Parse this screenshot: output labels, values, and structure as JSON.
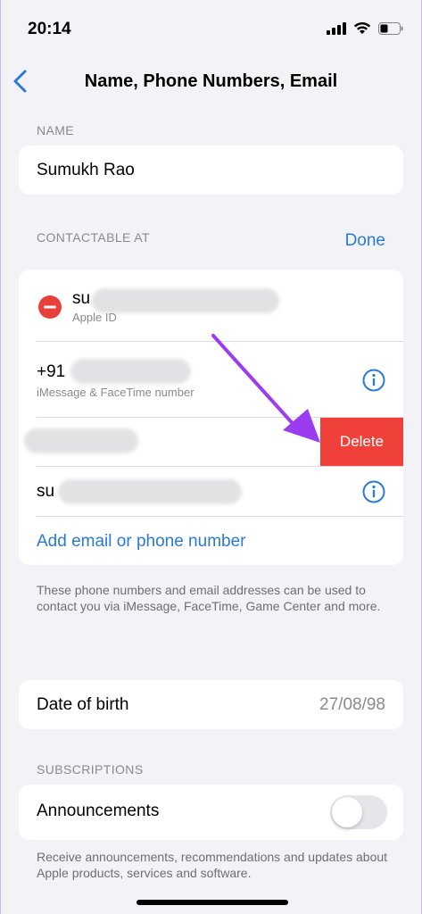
{
  "status": {
    "time": "20:14"
  },
  "nav": {
    "title": "Name, Phone Numbers, Email"
  },
  "name_section": {
    "label": "NAME",
    "value": "Sumukh Rao"
  },
  "contactable": {
    "label": "CONTACTABLE AT",
    "done_label": "Done",
    "items": [
      {
        "prefix": "su",
        "subtitle": "Apple ID"
      },
      {
        "prefix": "+91",
        "subtitle": "iMessage & FaceTime number"
      },
      {
        "prefix": "",
        "delete_label": "Delete"
      },
      {
        "prefix": "su"
      }
    ],
    "add_label": "Add email or phone number",
    "footer": "These phone numbers and email addresses can be used to contact you via iMessage, FaceTime, Game Center and more."
  },
  "dob": {
    "label": "Date of birth",
    "value": "27/08/98"
  },
  "subscriptions": {
    "label": "SUBSCRIPTIONS",
    "announcements_label": "Announcements",
    "announcements_on": false,
    "footer": "Receive announcements, recommendations and updates about Apple products, services and software."
  },
  "colors": {
    "accent": "#2a7ad6",
    "delete": "#f0403a",
    "remove": "#e8413c",
    "arrow": "#9b3cf0"
  }
}
